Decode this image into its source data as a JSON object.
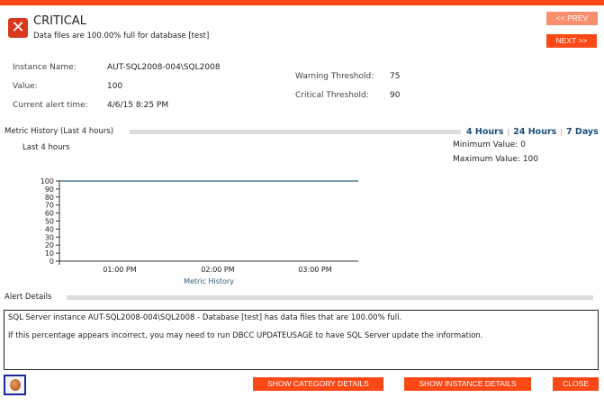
{
  "header": {
    "severity": "CRITICAL",
    "message": "Data files are 100.00% full for database [test]",
    "icon": "critical-x-icon"
  },
  "nav": {
    "prev": "<< PREV",
    "next": "NEXT >>"
  },
  "info": {
    "instance_label": "Instance Name:",
    "instance_value": "AUT-SQL2008-004\\SQL2008",
    "value_label": "Value:",
    "value_value": "100",
    "time_label": "Current alert time:",
    "time_value": "4/6/15 8:25 PM",
    "warning_label": "Warning Threshold:",
    "warning_value": "75",
    "critical_label": "Critical Threshold:",
    "critical_value": "90"
  },
  "metric": {
    "section_title": "Metric History (Last 4 hours)",
    "ranges": [
      "4 Hours",
      "24 Hours",
      "7 Days"
    ],
    "subtitle": "Last 4 hours",
    "min_label": "Minimum Value:",
    "min_value": "0",
    "max_label": "Maximum Value:",
    "max_value": "100"
  },
  "chart_data": {
    "type": "line",
    "xlabel": "Metric History",
    "x_ticks": [
      "01:00 PM",
      "02:00 PM",
      "03:00 PM"
    ],
    "y_ticks": [
      0,
      10,
      20,
      30,
      40,
      50,
      60,
      70,
      80,
      90,
      100
    ],
    "ylim": [
      0,
      100
    ],
    "series": [
      {
        "values": [
          100,
          100,
          100,
          100,
          100
        ]
      }
    ],
    "line_color": "#2c5f7a",
    "grid": false
  },
  "alert": {
    "section_title": "Alert Details",
    "line1": "SQL Server instance AUT-SQL2008-004\\SQL2008 - Database [test] has data files that are 100.00% full.",
    "line2": "If this percentage appears incorrect, you may need to run DBCC UPDATEUSAGE to have SQL Server update the information."
  },
  "buttons": {
    "category": "SHOW CATEGORY DETAILS",
    "instance": "SHOW INSTANCE DETAILS",
    "close": "CLOSE"
  },
  "colors": {
    "accent": "#fc4814",
    "link": "#1d4f7a"
  }
}
